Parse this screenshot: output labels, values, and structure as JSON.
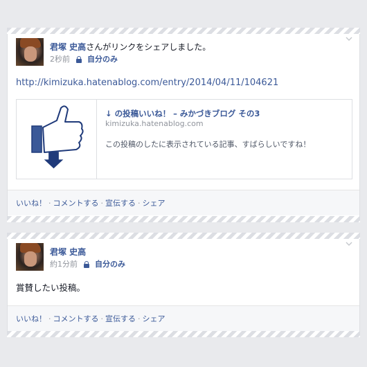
{
  "posts": [
    {
      "author": "君塚 史高",
      "action": "さんがリンクをシェアしました。",
      "time": "2秒前",
      "privacy": "自分のみ",
      "link_url": "http://kimizuka.hatenablog.com/entry/2014/04/11/104621",
      "attachment": {
        "title": "↓ の投稿いいね！ – みかづきブログ その3",
        "domain": "kimizuka.hatenablog.com",
        "description": "この投稿のしたに表示されている記事、すばらしいですね！",
        "image": "thumbs-up-icon"
      },
      "actions": [
        "いいね！",
        "コメントする",
        "宣伝する",
        "シェア"
      ]
    },
    {
      "author": "君塚 史高",
      "time": "約1分前",
      "privacy": "自分のみ",
      "text": "賞賛したい投稿。",
      "actions": [
        "いいね！",
        "コメントする",
        "宣伝する",
        "シェア"
      ]
    }
  ],
  "separator": "·",
  "colors": {
    "link": "#3b5998",
    "background": "#e9eaed",
    "meta": "#90949c"
  }
}
